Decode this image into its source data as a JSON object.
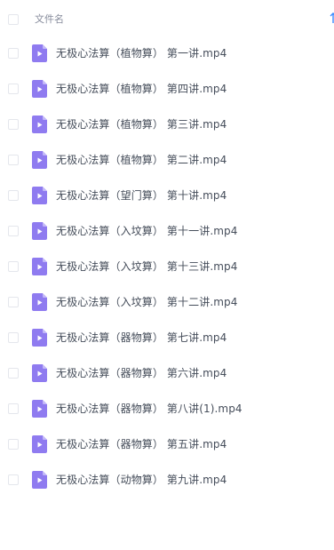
{
  "header": {
    "column_label": "文件名"
  },
  "files": [
    {
      "name": "无极心法算（植物算） 第一讲.mp4",
      "icon": "video-file-icon"
    },
    {
      "name": "无极心法算（植物算） 第四讲.mp4",
      "icon": "video-file-icon"
    },
    {
      "name": "无极心法算（植物算） 第三讲.mp4",
      "icon": "video-file-icon"
    },
    {
      "name": "无极心法算（植物算） 第二讲.mp4",
      "icon": "video-file-icon"
    },
    {
      "name": "无极心法算（望门算） 第十讲.mp4",
      "icon": "video-file-icon"
    },
    {
      "name": "无极心法算（入坟算） 第十一讲.mp4",
      "icon": "video-file-icon"
    },
    {
      "name": "无极心法算（入坟算） 第十三讲.mp4",
      "icon": "video-file-icon"
    },
    {
      "name": "无极心法算（入坟算） 第十二讲.mp4",
      "icon": "video-file-icon"
    },
    {
      "name": "无极心法算（器物算） 第七讲.mp4",
      "icon": "video-file-icon"
    },
    {
      "name": "无极心法算（器物算） 第六讲.mp4",
      "icon": "video-file-icon"
    },
    {
      "name": "无极心法算（器物算） 第八讲(1).mp4",
      "icon": "video-file-icon"
    },
    {
      "name": "无极心法算（器物算） 第五讲.mp4",
      "icon": "video-file-icon"
    },
    {
      "name": "无极心法算（动物算） 第九讲.mp4",
      "icon": "video-file-icon"
    }
  ],
  "colors": {
    "icon_fill": "#8f7bf0",
    "icon_fold": "#c3b8f8",
    "text": "#454d5a",
    "header_text": "#878c9c",
    "accent": "#3b8cff"
  }
}
